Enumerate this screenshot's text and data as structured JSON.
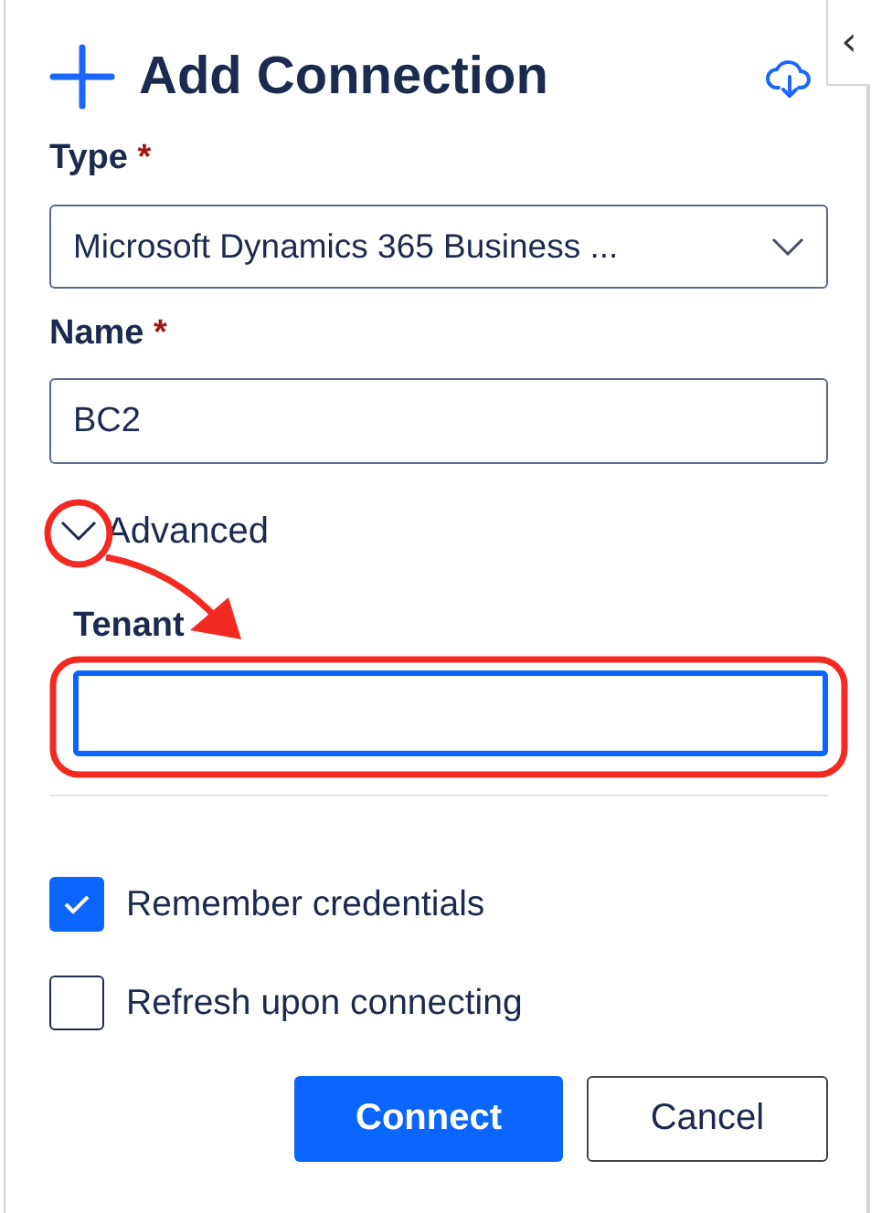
{
  "collapse_tab": {
    "glyph": "‹"
  },
  "header": {
    "title": "Add Connection"
  },
  "type_field": {
    "label": "Type",
    "required_mark": "*",
    "value": "Microsoft Dynamics 365 Business ..."
  },
  "name_field": {
    "label": "Name",
    "required_mark": "*",
    "value": "BC2"
  },
  "advanced": {
    "label": "Advanced",
    "expanded": true,
    "tenant_field": {
      "label": "Tenant",
      "focused": true
    }
  },
  "options": [
    {
      "label": "Remember credentials",
      "checked": true
    },
    {
      "label": "Refresh upon connecting",
      "checked": false
    }
  ],
  "buttons": [
    {
      "label": "Connect",
      "kind": "primary"
    },
    {
      "label": "Cancel",
      "kind": "secondary"
    }
  ]
}
